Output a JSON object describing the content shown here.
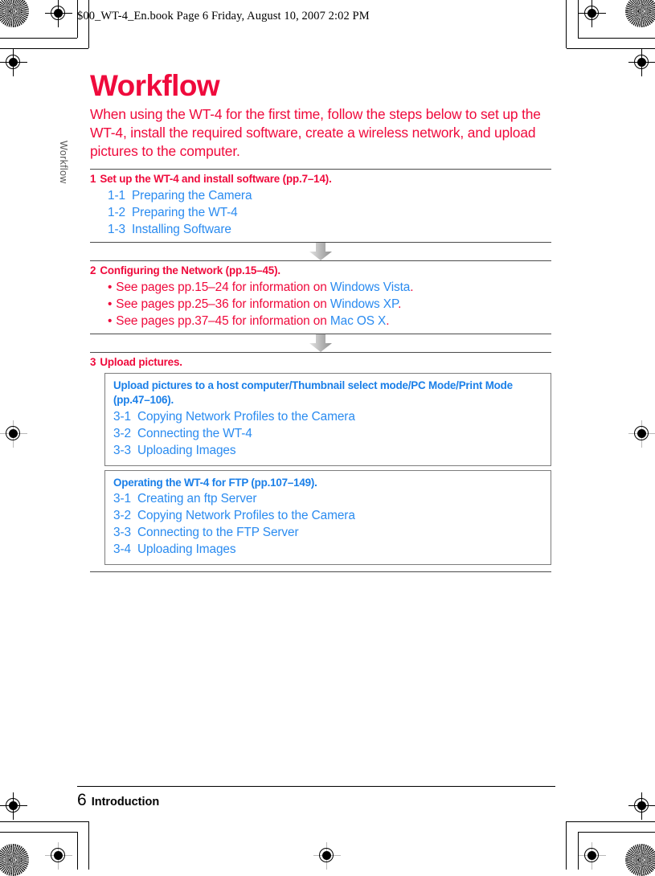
{
  "header": {
    "book_line": "$00_WT-4_En.book  Page 6  Friday, August 10, 2007  2:02 PM"
  },
  "side_tab": {
    "label": "Workflow"
  },
  "colors": {
    "red": "#ef0a3c",
    "blue": "#2a8bf0",
    "heading_blue": "#1a7fe8",
    "rule": "#4b4b4b",
    "box_border": "#7d7d7d"
  },
  "page": {
    "title": "Workflow",
    "intro": "When using the WT-4 for the first time, follow the steps below to set up the WT-4, install the required software, create a wireless network, and upload pictures to the computer."
  },
  "steps": [
    {
      "number": "1",
      "heading": "Set up the WT-4 and install software (pp.7–14).",
      "items": [
        {
          "index": "1-1",
          "label": "Preparing the Camera"
        },
        {
          "index": "1-2",
          "label": "Preparing the WT-4"
        },
        {
          "index": "1-3",
          "label": "Installing Software"
        }
      ]
    },
    {
      "number": "2",
      "heading": "Configuring the Network (pp.15–45).",
      "bullets": [
        {
          "dot": "•",
          "text": "See pages pp.15–24 for information on ",
          "os": "Windows Vista",
          "tail": "."
        },
        {
          "dot": "•",
          "text": "See pages pp.25–36 for information on ",
          "os": "Windows XP",
          "tail": "."
        },
        {
          "dot": "•",
          "text": "See pages pp.37–45 for information on ",
          "os": "Mac OS X",
          "tail": "."
        }
      ]
    },
    {
      "number": "3",
      "heading": "Upload pictures.",
      "boxes": [
        {
          "title": "Upload pictures to a host computer/Thumbnail select mode/PC Mode/Print Mode (pp.47–106).",
          "items": [
            {
              "index": "3-1",
              "label": "Copying Network Profiles to the Camera"
            },
            {
              "index": "3-2",
              "label": "Connecting the WT-4"
            },
            {
              "index": "3-3",
              "label": "Uploading Images"
            }
          ]
        },
        {
          "title": "Operating the WT-4 for FTP  (pp.107–149).",
          "items": [
            {
              "index": "3-1",
              "label": "Creating an ftp Server"
            },
            {
              "index": "3-2",
              "label": "Copying Network Profiles to the Camera"
            },
            {
              "index": "3-3",
              "label": "Connecting to the FTP Server"
            },
            {
              "index": "3-4",
              "label": "Uploading Images"
            }
          ]
        }
      ]
    }
  ],
  "footer": {
    "page_number": "6",
    "section": "Introduction"
  }
}
